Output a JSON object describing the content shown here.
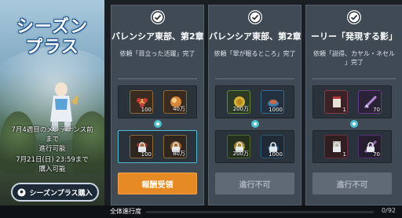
{
  "banner": {
    "title_line1": "シーズン",
    "title_line2": "プラス",
    "note_line1": "7月4週目のメンテナンス前",
    "note_line2": "まで",
    "note_line3": "進行可能",
    "note_line4": "7月21日(日) 23:59まで",
    "note_line5": "購入可能",
    "buy_label": "シーズンプラス購入"
  },
  "cards": [
    {
      "chapter": "バレンシア東部、第2章",
      "request": "依頼「目立った活躍」完了",
      "request2": "",
      "top_rewards": [
        {
          "icon": "flower-icon",
          "count": "100",
          "locked": false
        },
        {
          "icon": "orb-icon",
          "count": "40万",
          "locked": false
        }
      ],
      "bot_rewards": [
        {
          "icon": "flower-icon",
          "count": "100",
          "locked": true
        },
        {
          "icon": "orb-icon",
          "count": "80万",
          "locked": true
        }
      ],
      "action": "報酬受領",
      "action_state": "claim"
    },
    {
      "chapter": "バレンシア東部、第2章",
      "request": "依頼「翠が眠るところ」完了",
      "request2": "",
      "top_rewards": [
        {
          "icon": "coin-icon",
          "count": "200万",
          "locked": false
        },
        {
          "icon": "food-icon",
          "count": "1000",
          "locked": false
        }
      ],
      "bot_rewards": [
        {
          "icon": "coin-icon",
          "count": "200万",
          "locked": true
        },
        {
          "icon": "food-icon",
          "count": "1000",
          "locked": true
        }
      ],
      "action": "進行不可",
      "action_state": "off"
    },
    {
      "chapter": "ーリー「発現する影」",
      "request": "依頼「説得、カヤル・ネセル",
      "request2": "」完了",
      "top_rewards": [
        {
          "icon": "scroll-icon",
          "count": "1",
          "locked": false
        },
        {
          "icon": "weapon-icon",
          "count": "70",
          "locked": false
        }
      ],
      "bot_rewards": [
        {
          "icon": "scroll-icon",
          "count": "1",
          "locked": true
        },
        {
          "icon": "weapon-icon",
          "count": "70",
          "locked": true
        }
      ],
      "action": "進行不可",
      "action_state": "off"
    }
  ],
  "progress": {
    "label": "全体進行度",
    "value": "0/92",
    "fraction": 0
  },
  "colors": {
    "accent": "#4fbfd0",
    "claim": "#e58a24"
  }
}
